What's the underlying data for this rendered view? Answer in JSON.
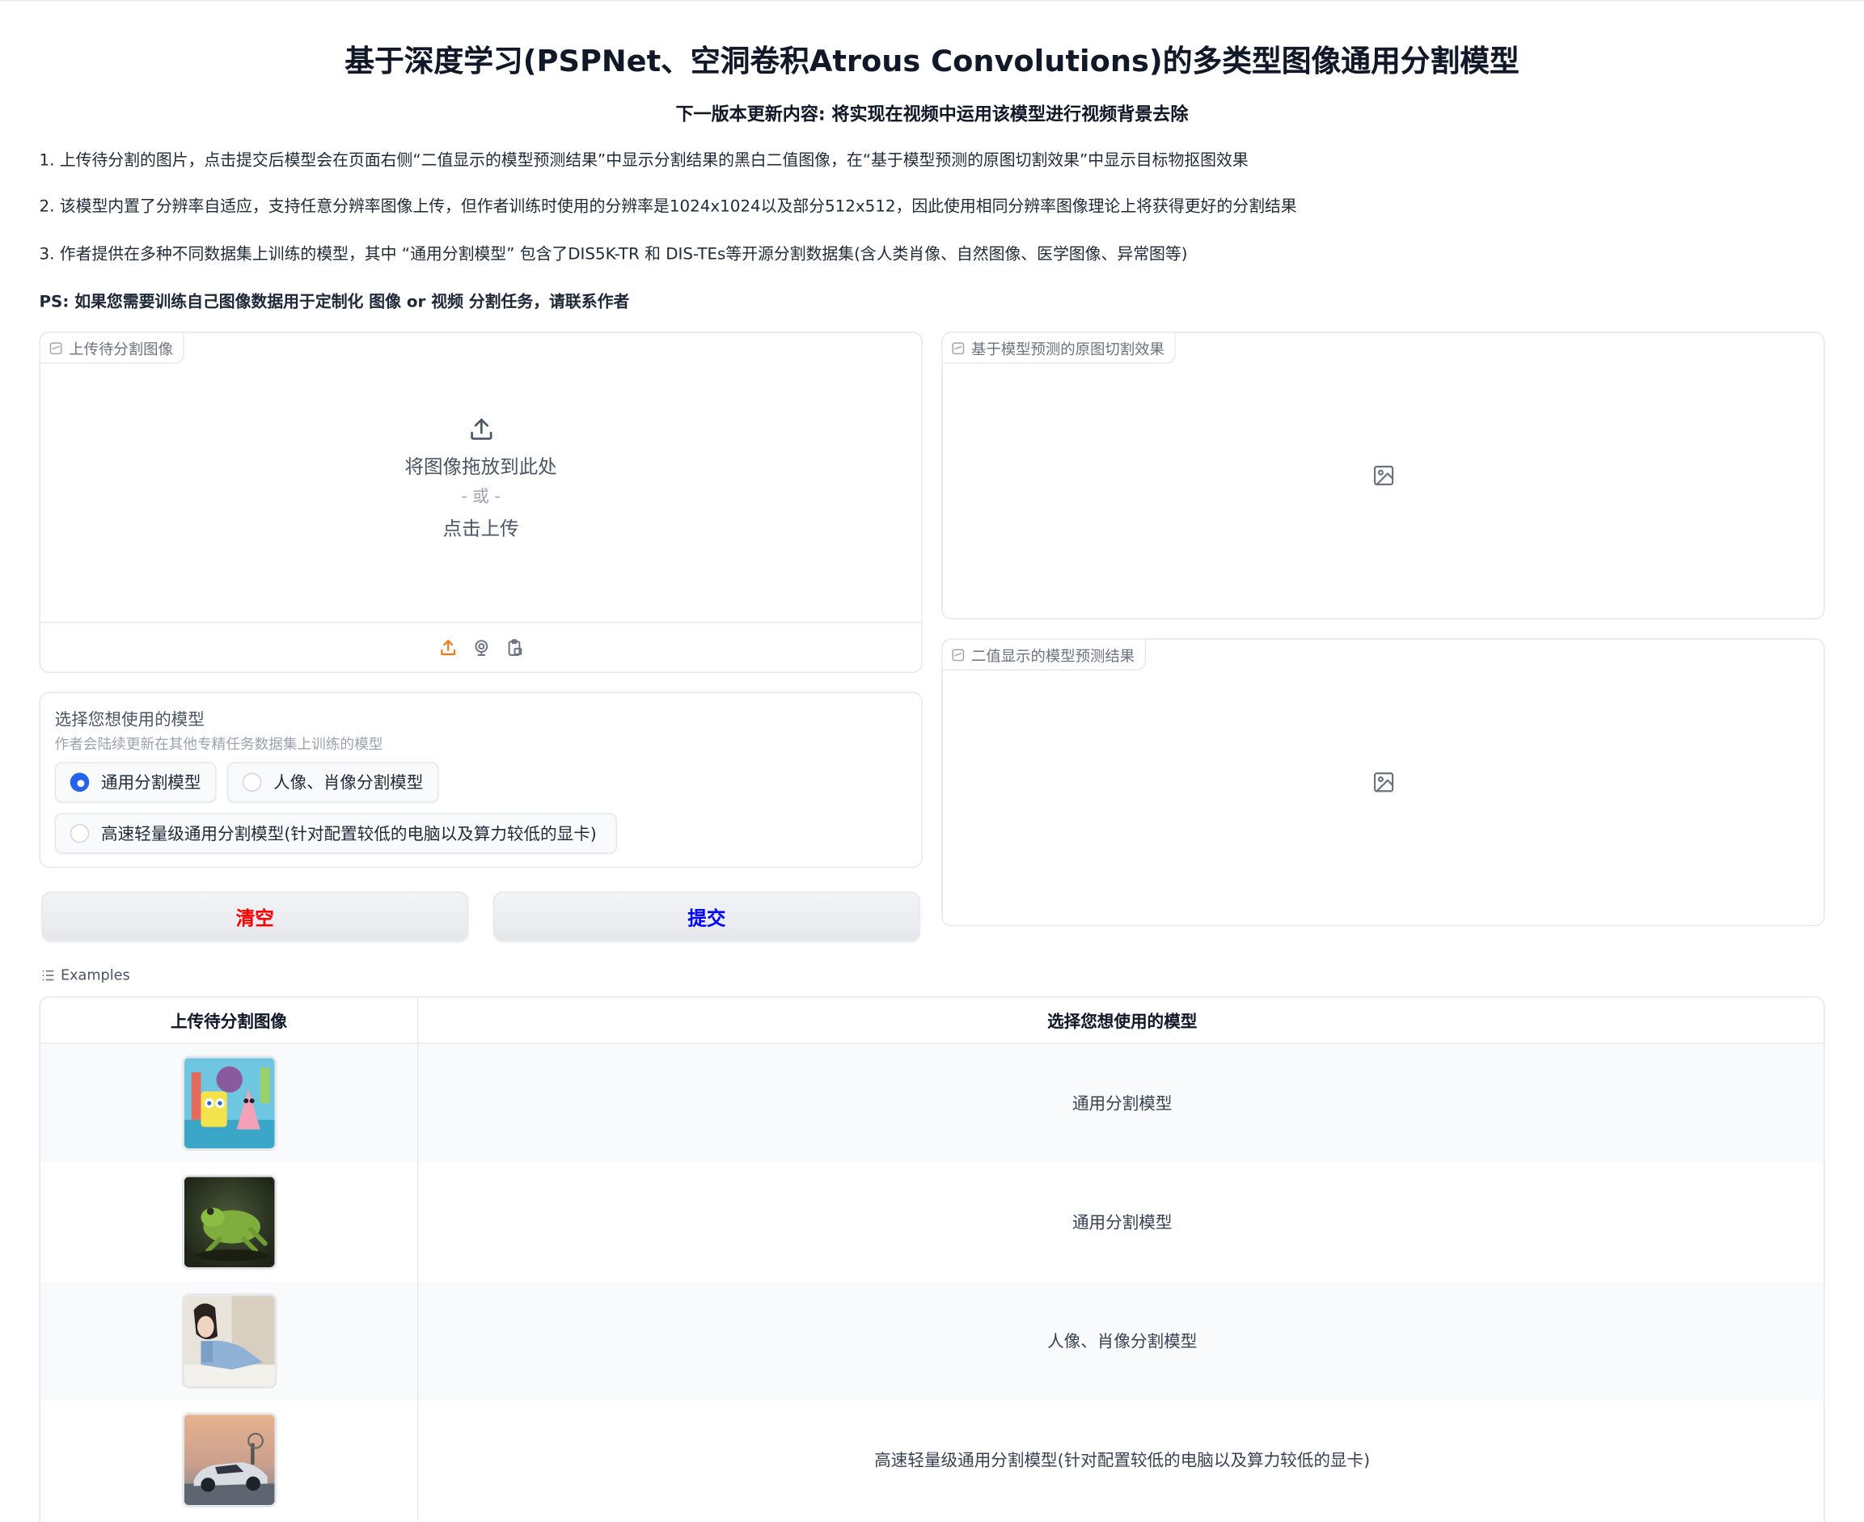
{
  "header": {
    "title": "基于深度学习(PSPNet、空洞卷积Atrous Convolutions)的多类型图像通用分割模型",
    "subtitle": "下一版本更新内容: 将实现在视频中运用该模型进行视频背景去除"
  },
  "description": {
    "p1": "1. 上传待分割的图片，点击提交后模型会在页面右侧“二值显示的模型预测结果”中显示分割结果的黑白二值图像，在“基于模型预测的原图切割效果”中显示目标物抠图效果",
    "p2": "2. 该模型内置了分辨率自适应，支持任意分辨率图像上传，但作者训练时使用的分辨率是1024x1024以及部分512x512，因此使用相同分辨率图像理论上将获得更好的分割结果",
    "p3": "3. 作者提供在多种不同数据集上训练的模型，其中 “通用分割模型” 包含了DIS5K-TR 和 DIS-TEs等开源分割数据集(含人类肖像、自然图像、医学图像、异常图等)",
    "p4": "PS: 如果您需要训练自己图像数据用于定制化 图像 or 视频 分割任务，请联系作者"
  },
  "upload": {
    "label": "上传待分割图像",
    "drop_text": "将图像拖放到此处",
    "or_text": "- 或 -",
    "click_text": "点击上传"
  },
  "model_select": {
    "label": "选择您想使用的模型",
    "info": "作者会陆续更新在其他专精任务数据集上训练的模型",
    "options": [
      "通用分割模型",
      "人像、肖像分割模型",
      "高速轻量级通用分割模型(针对配置较低的电脑以及算力较低的显卡)"
    ],
    "selected": "通用分割模型"
  },
  "buttons": {
    "clear": "清空",
    "submit": "提交",
    "clear_color": "#ff0000",
    "submit_color": "#0000ff"
  },
  "outputs": {
    "cutout_label": "基于模型预测的原图切割效果",
    "mask_label": "二值显示的模型预测结果"
  },
  "examples": {
    "label": "Examples",
    "headers": [
      "上传待分割图像",
      "选择您想使用的模型"
    ],
    "rows": [
      {
        "image_icon": "cartoon-characters-thumbnail",
        "model": "通用分割模型"
      },
      {
        "image_icon": "frog-thumbnail",
        "model": "通用分割模型"
      },
      {
        "image_icon": "portrait-woman-thumbnail",
        "model": "人像、肖像分割模型"
      },
      {
        "image_icon": "sports-car-thumbnail",
        "model": "高速轻量级通用分割模型(针对配置较低的电脑以及算力较低的显卡)"
      }
    ]
  },
  "colors": {
    "accent": "#2563eb",
    "upload_icon": "#f97316"
  }
}
